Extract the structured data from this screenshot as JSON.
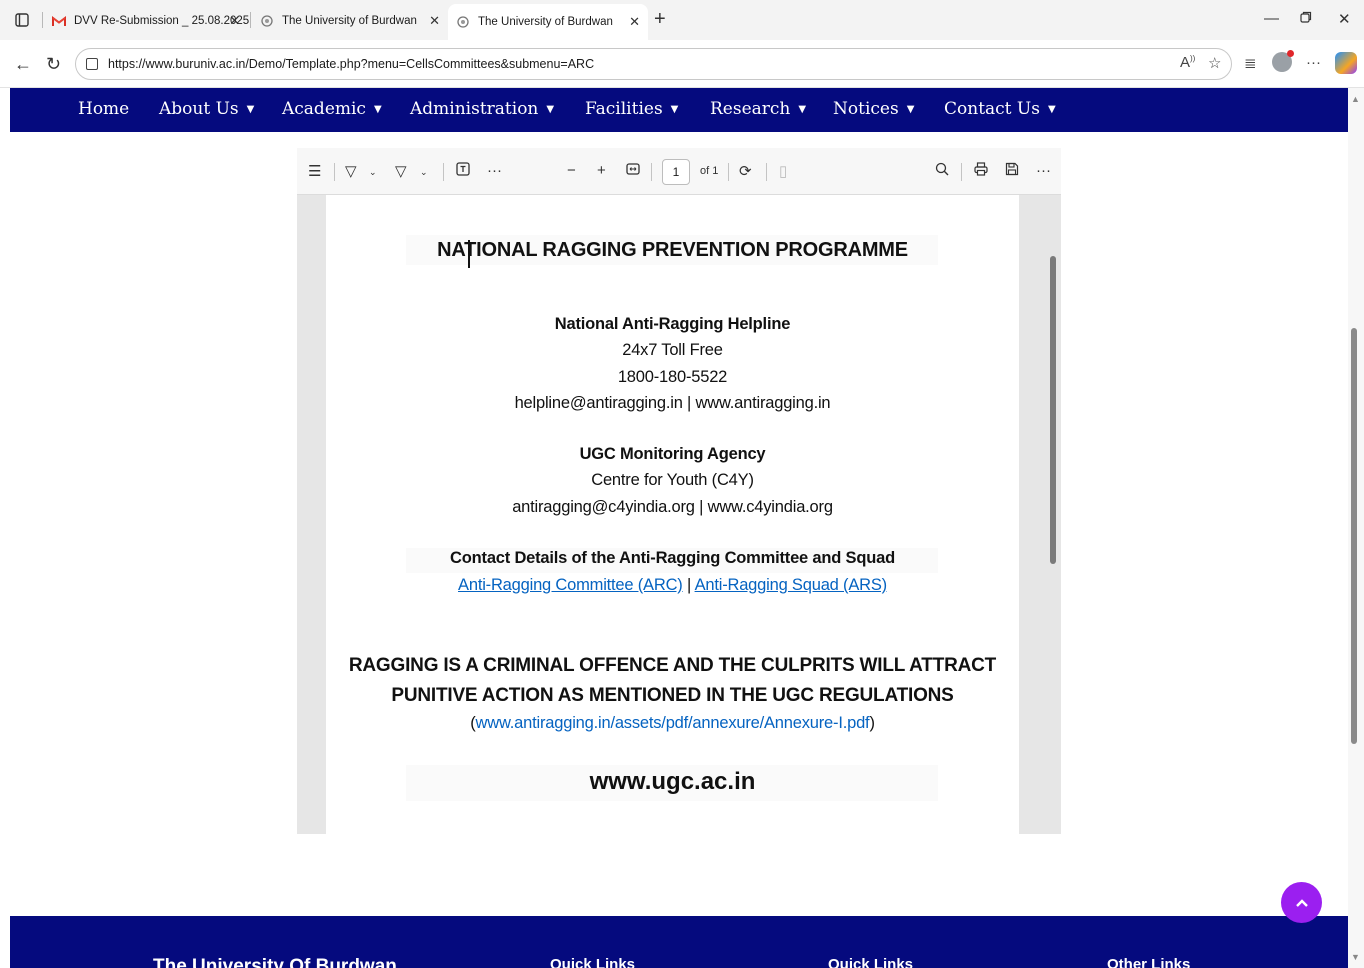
{
  "browser": {
    "tabs": [
      {
        "title": "DVV Re-Submission _ 25.08.2025",
        "favicon": "gmail-icon",
        "active": false
      },
      {
        "title": "The University of Burdwan",
        "favicon": "globe-icon",
        "active": false
      },
      {
        "title": "The University of Burdwan",
        "favicon": "globe-icon",
        "active": true
      }
    ],
    "url": "https://www.buruniv.ac.in/Demo/Template.php?menu=CellsCommittees&submenu=ARC"
  },
  "nav": {
    "items": [
      {
        "label": "Home",
        "dropdown": false
      },
      {
        "label": "About Us",
        "dropdown": true
      },
      {
        "label": "Academic",
        "dropdown": true
      },
      {
        "label": "Administration",
        "dropdown": true
      },
      {
        "label": "Facilities",
        "dropdown": true
      },
      {
        "label": "Research",
        "dropdown": true
      },
      {
        "label": "Notices",
        "dropdown": true
      },
      {
        "label": "Contact Us",
        "dropdown": true
      }
    ],
    "bg_color": "#050a7e"
  },
  "pdf_toolbar": {
    "page_current": "1",
    "page_total": "of 1"
  },
  "doc": {
    "title": "NATIONAL RAGGING PREVENTION PROGRAMME",
    "helpline_heading": "National Anti-Ragging Helpline",
    "helpline_line1": "24x7 Toll Free",
    "helpline_phone": "1800-180-5522",
    "helpline_contacts": "helpline@antiragging.in | www.antiragging.in",
    "agency_heading": "UGC Monitoring Agency",
    "agency_name": "Centre for Youth (C4Y)",
    "agency_contacts": "antiragging@c4yindia.org | www.c4yindia.org",
    "contact_heading": "Contact Details of the Anti-Ragging Committee and Squad",
    "link_arc": "Anti-Ragging Committee (ARC)",
    "separator": "|",
    "link_ars": "Anti-Ragging Squad (ARS)",
    "warning_line1": "RAGGING IS A CRIMINAL OFFENCE AND THE CULPRITS WILL ATTRACT",
    "warning_line2": "PUNITIVE ACTION AS MENTIONED IN THE UGC REGULATIONS",
    "annexure_open": "(",
    "annexure_url": "www.antiragging.in/assets/pdf/annexure/Annexure-I.pdf",
    "annexure_close": ")",
    "ugc_site": "www.ugc.ac.in",
    "link_color": "#0563c1"
  },
  "footer": {
    "col1_title": "The University Of Burdwan",
    "col2_title": "Quick Links",
    "col3_title": "Quick Links",
    "col4_title": "Other Links"
  },
  "scroll_top": {
    "icon": "chevron-up-icon",
    "color": "#9b1ff0"
  }
}
